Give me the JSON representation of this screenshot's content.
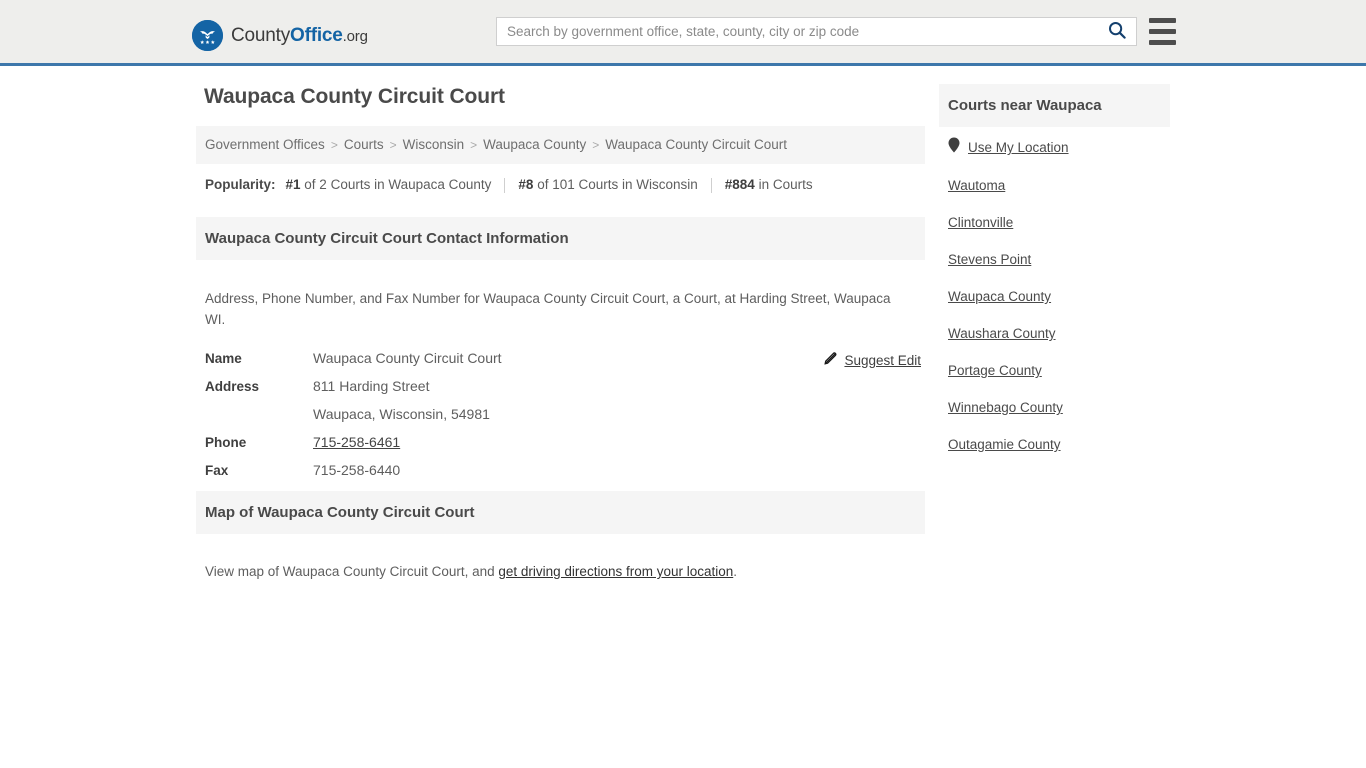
{
  "header": {
    "brand": {
      "part1": "County",
      "part2": "Office",
      "part3": ".org",
      "logo_icon": "eagle-stars-seal-icon"
    },
    "search": {
      "placeholder": "Search by government office, state, county, city or zip code",
      "value": "",
      "search_icon": "search-icon"
    },
    "menu_icon": "hamburger-menu-icon",
    "accent_color": "#3d77ab",
    "background_color": "#eeeeec"
  },
  "main": {
    "title": "Waupaca County Circuit Court",
    "breadcrumb": [
      "Government Offices",
      "Courts",
      "Wisconsin",
      "Waupaca County",
      "Waupaca County Circuit Court"
    ],
    "breadcrumb_separator": ">",
    "popularity": {
      "label": "Popularity:",
      "items": [
        {
          "rank": "#1",
          "rest": " of 2 Courts in Waupaca County"
        },
        {
          "rank": "#8",
          "rest": " of 101 Courts in Wisconsin"
        },
        {
          "rank": "#884",
          "rest": " in Courts"
        }
      ]
    },
    "contact_section": {
      "heading": "Waupaca County Circuit Court Contact Information",
      "description": "Address, Phone Number, and Fax Number for Waupaca County Circuit Court, a Court, at Harding Street, Waupaca WI.",
      "suggest_edit": {
        "label": "Suggest Edit",
        "icon": "edit-pencil-icon"
      },
      "rows": [
        {
          "label": "Name",
          "value": "Waupaca County Circuit Court",
          "link": false
        },
        {
          "label": "Address",
          "value": "811 Harding Street",
          "link": false
        },
        {
          "label": "",
          "value": "Waupaca, Wisconsin, 54981",
          "link": false
        },
        {
          "label": "Phone",
          "value": "715-258-6461",
          "link": true
        },
        {
          "label": "Fax",
          "value": "715-258-6440",
          "link": false
        }
      ]
    },
    "map_section": {
      "heading": "Map of Waupaca County Circuit Court",
      "description_before": "View map of Waupaca County Circuit Court, and ",
      "description_link": "get driving directions from your location",
      "description_after": "."
    }
  },
  "sidebar": {
    "heading": "Courts near Waupaca",
    "use_my_location": {
      "label": "Use My Location",
      "icon": "map-pin-icon"
    },
    "items": [
      {
        "label": "Wautoma"
      },
      {
        "label": "Clintonville"
      },
      {
        "label": "Stevens Point"
      },
      {
        "label": "Waupaca County"
      },
      {
        "label": "Waushara County"
      },
      {
        "label": "Portage County"
      },
      {
        "label": "Winnebago County"
      },
      {
        "label": "Outagamie County"
      }
    ]
  }
}
